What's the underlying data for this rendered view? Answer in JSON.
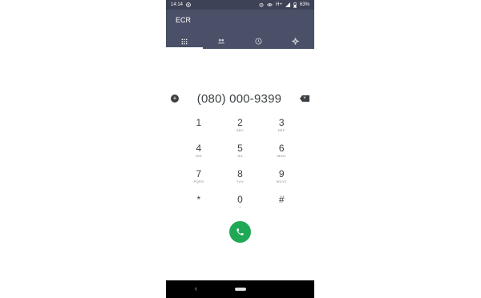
{
  "status_bar": {
    "time": "14:14",
    "network": "H+",
    "battery": "63%",
    "icons": [
      "app-notification-icon",
      "alarm-icon",
      "visibility-icon",
      "signal-icon",
      "battery-icon"
    ]
  },
  "app": {
    "title": "ECR"
  },
  "tabs": [
    {
      "icon": "dialpad-icon",
      "active": true
    },
    {
      "icon": "contacts-icon",
      "active": false
    },
    {
      "icon": "recents-clock-icon",
      "active": false
    },
    {
      "icon": "settings-gear-icon",
      "active": false
    }
  ],
  "dialer": {
    "number": "(080) 000-9399",
    "add_contact_icon": "add-contact-icon",
    "backspace_icon": "backspace-icon"
  },
  "keypad": [
    {
      "digit": "1",
      "letters": ""
    },
    {
      "digit": "2",
      "letters": "ABC"
    },
    {
      "digit": "3",
      "letters": "DEF"
    },
    {
      "digit": "4",
      "letters": "GHI"
    },
    {
      "digit": "5",
      "letters": "JKL"
    },
    {
      "digit": "6",
      "letters": "MNO"
    },
    {
      "digit": "7",
      "letters": "PQRS"
    },
    {
      "digit": "8",
      "letters": "TUV"
    },
    {
      "digit": "9",
      "letters": "WXYZ"
    },
    {
      "digit": "*",
      "letters": ""
    },
    {
      "digit": "0",
      "letters": "+"
    },
    {
      "digit": "#",
      "letters": ""
    }
  ],
  "call_button": {
    "icon": "phone-call-icon",
    "color": "#1fa855"
  },
  "navigation_bar": {
    "back_icon": "nav-back-icon",
    "home_icon": "nav-home-pill-icon"
  },
  "colors": {
    "toolbar": "#4a5067",
    "status_bar": "#3d4256",
    "text": "#3c4043"
  }
}
